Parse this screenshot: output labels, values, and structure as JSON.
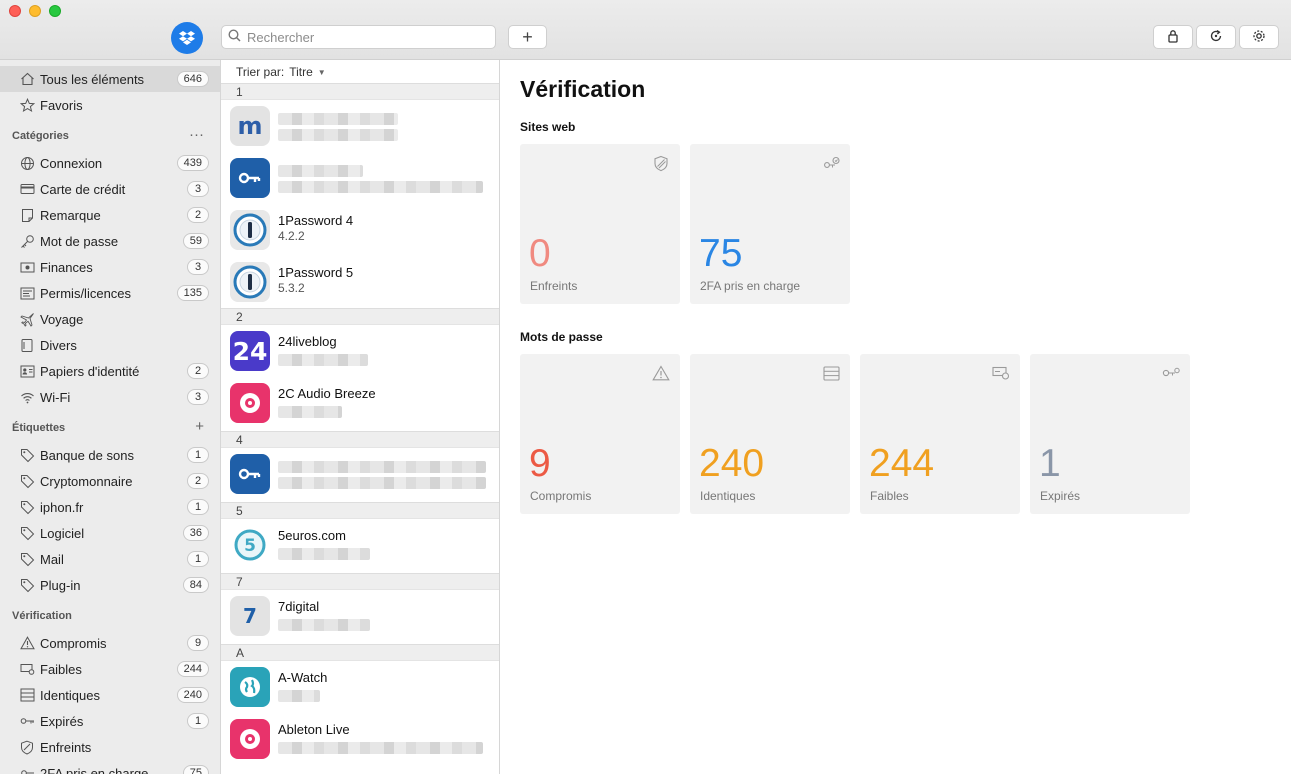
{
  "toolbar": {
    "search_placeholder": "Rechercher",
    "add_label": "+"
  },
  "sidebar": {
    "top": [
      {
        "label": "Tous les éléments",
        "count": "646",
        "icon": "home-icon"
      },
      {
        "label": "Favoris",
        "count": "",
        "icon": "star-icon"
      }
    ],
    "categories_title": "Catégories",
    "categories_action": "···",
    "categories": [
      {
        "label": "Connexion",
        "count": "439",
        "icon": "globe-icon"
      },
      {
        "label": "Carte de crédit",
        "count": "3",
        "icon": "credit-card-icon"
      },
      {
        "label": "Remarque",
        "count": "2",
        "icon": "note-icon"
      },
      {
        "label": "Mot de passe",
        "count": "59",
        "icon": "key-icon"
      },
      {
        "label": "Finances",
        "count": "3",
        "icon": "banknote-icon"
      },
      {
        "label": "Permis/licences",
        "count": "135",
        "icon": "license-icon"
      },
      {
        "label": "Voyage",
        "count": "",
        "icon": "plane-icon"
      },
      {
        "label": "Divers",
        "count": "",
        "icon": "folder-icon"
      },
      {
        "label": "Papiers d'identité",
        "count": "2",
        "icon": "id-card-icon"
      },
      {
        "label": "Wi-Fi",
        "count": "3",
        "icon": "wifi-icon"
      }
    ],
    "tags_title": "Étiquettes",
    "tags_action": "+",
    "tags": [
      {
        "label": "Banque de sons",
        "count": "1"
      },
      {
        "label": "Cryptomonnaire",
        "count": "2"
      },
      {
        "label": "iphon.fr",
        "count": "1"
      },
      {
        "label": "Logiciel",
        "count": "36"
      },
      {
        "label": "Mail",
        "count": "1"
      },
      {
        "label": "Plug-in",
        "count": "84"
      }
    ],
    "verification_title": "Vérification",
    "verification": [
      {
        "label": "Compromis",
        "count": "9",
        "icon": "warning-icon"
      },
      {
        "label": "Faibles",
        "count": "244",
        "icon": "weak-icon"
      },
      {
        "label": "Identiques",
        "count": "240",
        "icon": "duplicate-icon"
      },
      {
        "label": "Expirés",
        "count": "1",
        "icon": "expired-key-icon"
      },
      {
        "label": "Enfreints",
        "count": "",
        "icon": "shield-icon"
      },
      {
        "label": "2FA pris en charge",
        "count": "75",
        "icon": "two-factor-icon"
      }
    ]
  },
  "list": {
    "sort_label": "Trier par:",
    "sort_value": "Titre",
    "groups": {
      "g1": "1",
      "g2": "2",
      "g4": "4",
      "g5": "5",
      "g7": "7",
      "gA": "A"
    },
    "items": [
      {
        "title": "",
        "subtitle": ""
      },
      {
        "title": "",
        "subtitle": ""
      },
      {
        "title": "1Password 4",
        "subtitle": "4.2.2"
      },
      {
        "title": "1Password 5",
        "subtitle": "5.3.2"
      },
      {
        "title": "24liveblog",
        "subtitle": ""
      },
      {
        "title": "2C Audio Breeze",
        "subtitle": ""
      },
      {
        "title": "",
        "subtitle": ""
      },
      {
        "title": "5euros.com",
        "subtitle": ""
      },
      {
        "title": "7digital",
        "subtitle": ""
      },
      {
        "title": "A-Watch",
        "subtitle": ""
      },
      {
        "title": "Ableton Live",
        "subtitle": ""
      }
    ],
    "icon_text": {
      "m": "m",
      "twentyfour": "24",
      "seven": "7"
    }
  },
  "main": {
    "title": "Vérification",
    "websites_title": "Sites web",
    "passwords_title": "Mots de passe",
    "website_tiles": [
      {
        "value": "0",
        "label": "Enfreints",
        "color": "#f08a80"
      },
      {
        "value": "75",
        "label": "2FA pris en charge",
        "color": "#2a86e4"
      }
    ],
    "password_tiles": [
      {
        "value": "9",
        "label": "Compromis",
        "color": "#ec5a45"
      },
      {
        "value": "240",
        "label": "Identiques",
        "color": "#f0a020"
      },
      {
        "value": "244",
        "label": "Faibles",
        "color": "#f0a020"
      },
      {
        "value": "1",
        "label": "Expirés",
        "color": "#8a96a8"
      }
    ]
  }
}
